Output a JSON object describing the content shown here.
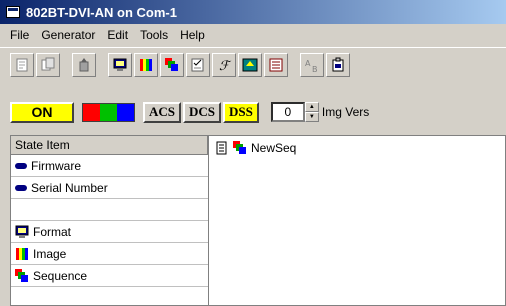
{
  "window": {
    "title": "802BT-DVI-AN on Com-1"
  },
  "menu": [
    "File",
    "Generator",
    "Edit",
    "Tools",
    "Help"
  ],
  "status": {
    "on_label": "ON",
    "colors": [
      "#ff0000",
      "#00c000",
      "#0000ff"
    ],
    "modes": [
      {
        "label": "ACS",
        "active": false
      },
      {
        "label": "DCS",
        "active": false
      },
      {
        "label": "DSS",
        "active": true
      }
    ],
    "img_vers_value": "0",
    "img_vers_label": "Img Vers"
  },
  "state_panel": {
    "header": "State Item",
    "items": [
      {
        "label": "Firmware",
        "icon": "connector-icon"
      },
      {
        "label": "Serial Number",
        "icon": "connector-icon"
      },
      {
        "label": "",
        "icon": ""
      },
      {
        "label": "Format",
        "icon": "monitor-icon"
      },
      {
        "label": "Image",
        "icon": "color-bars-icon"
      },
      {
        "label": "Sequence",
        "icon": "sequence-icon"
      }
    ]
  },
  "tree": {
    "root_label": "NewSeq"
  }
}
